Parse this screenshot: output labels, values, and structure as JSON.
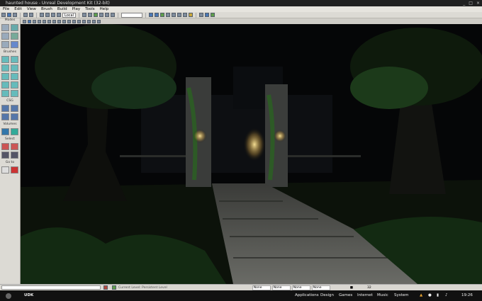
{
  "window": {
    "title": "haunted house - Unreal Development Kit (32-bit)",
    "controls": [
      "_",
      "□",
      "×"
    ]
  },
  "menu": [
    "File",
    "Edit",
    "View",
    "Brush",
    "Build",
    "Play",
    "Tools",
    "Help"
  ],
  "toolbar": {
    "coord_system": "Local"
  },
  "sidebar": {
    "sections": [
      {
        "label": "Modes"
      },
      {
        "label": "Brushes"
      },
      {
        "label": "CSG"
      },
      {
        "label": "Volumes"
      },
      {
        "label": "Select"
      },
      {
        "label": "Go to"
      }
    ]
  },
  "status": {
    "current_level": "Current Level: Persistent Level",
    "fields": [
      "None",
      "None",
      "None",
      "None"
    ],
    "zoom": "32"
  },
  "taskbar": {
    "menus": [
      "Applications",
      "Design",
      "Games",
      "Internet",
      "Music",
      "System"
    ],
    "clock": "19:26"
  },
  "colors": {
    "sky": "#050607",
    "foliage": "#1c3a1a",
    "stone": "#4a4c48",
    "lantern": "#f0d070"
  }
}
